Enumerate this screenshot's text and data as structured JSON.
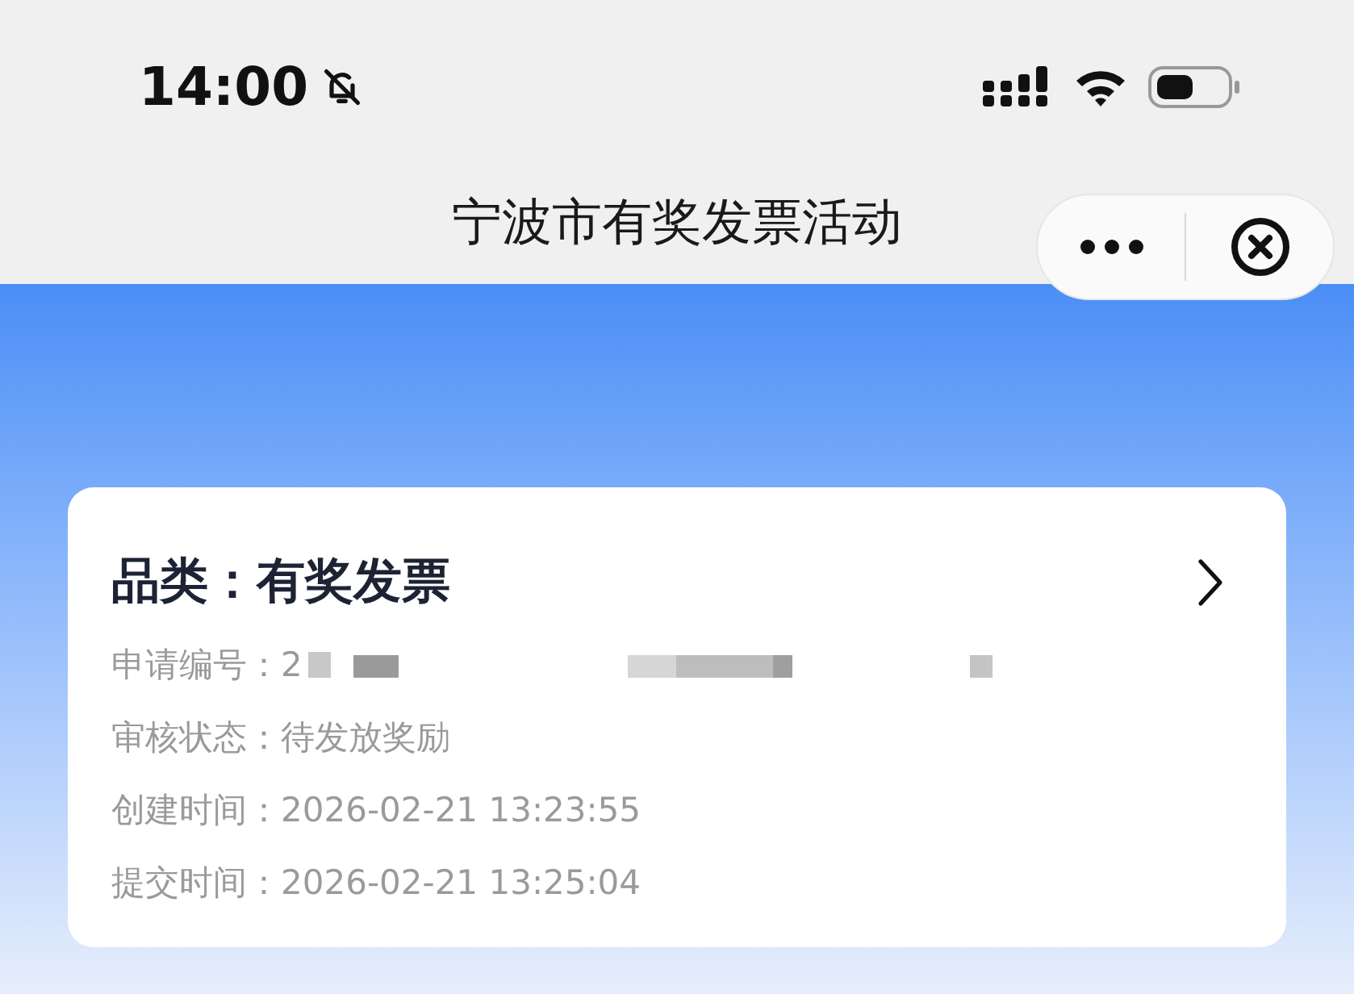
{
  "status_bar": {
    "time": "14:00",
    "muted": true
  },
  "nav": {
    "title": "宁波市有奖发票活动"
  },
  "card": {
    "title": "品类：有奖发票",
    "fields": [
      {
        "label": "申请编号：",
        "value": "2",
        "kind": "redacted"
      },
      {
        "label": "审核状态：",
        "value": "待发放奖励",
        "kind": "text"
      },
      {
        "label": "创建时间：",
        "value": "2026-02-21 13:23:55",
        "kind": "text"
      },
      {
        "label": "提交时间：",
        "value": "2026-02-21 13:25:04",
        "kind": "text"
      }
    ]
  }
}
